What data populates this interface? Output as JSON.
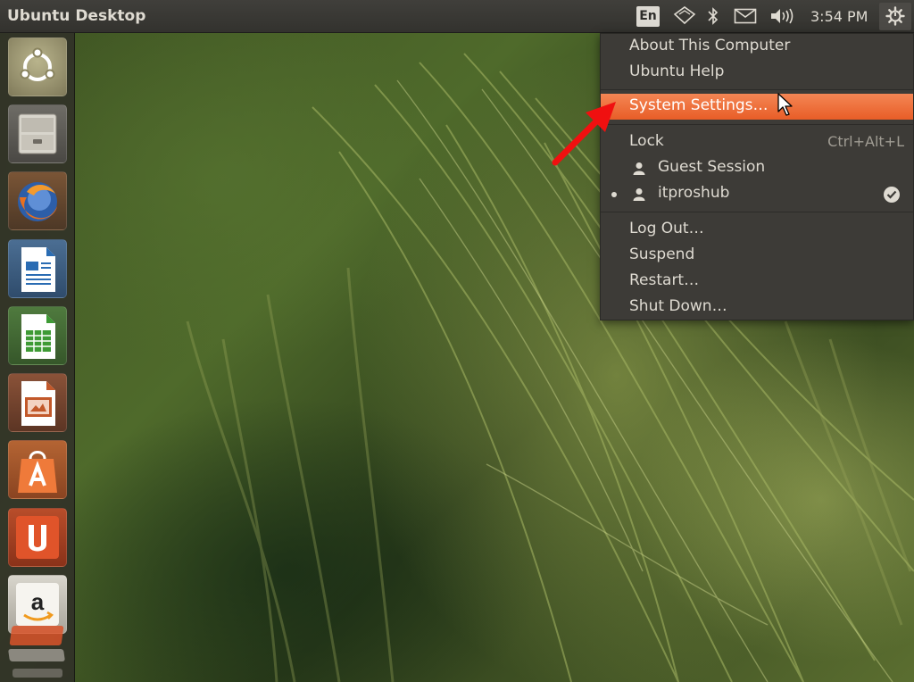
{
  "panel": {
    "title": "Ubuntu Desktop",
    "keyboard_layout": "En",
    "clock": "3:54 PM"
  },
  "indicators": [
    "network-wifi-icon",
    "bluetooth-icon",
    "mail-envelope-icon",
    "volume-icon",
    "session-gear-icon"
  ],
  "launcher": {
    "items": [
      {
        "name": "dash-home",
        "icon": "ubuntu-logo-icon"
      },
      {
        "name": "files",
        "icon": "file-cabinet-icon"
      },
      {
        "name": "firefox",
        "icon": "firefox-icon"
      },
      {
        "name": "libreoffice-writer",
        "icon": "writer-document-icon"
      },
      {
        "name": "libreoffice-calc",
        "icon": "calc-spreadsheet-icon"
      },
      {
        "name": "libreoffice-impress",
        "icon": "impress-presentation-icon"
      },
      {
        "name": "software-center",
        "icon": "shopping-bag-icon"
      },
      {
        "name": "ubuntu-one",
        "icon": "ubuntu-one-icon"
      },
      {
        "name": "amazon",
        "icon": "amazon-icon"
      }
    ]
  },
  "menu": {
    "about": "About This Computer",
    "help": "Ubuntu Help",
    "settings": "System Settings…",
    "lock": "Lock",
    "lock_shortcut": "Ctrl+Alt+L",
    "guest": "Guest Session",
    "current_user": "itproshub",
    "logout": "Log Out…",
    "suspend": "Suspend",
    "restart": "Restart…",
    "shutdown": "Shut Down…"
  },
  "colors": {
    "panel": "#3a3935",
    "menu_bg": "#3d3b37",
    "highlight": "#ee6a35",
    "annotation_arrow": "#f01010"
  }
}
